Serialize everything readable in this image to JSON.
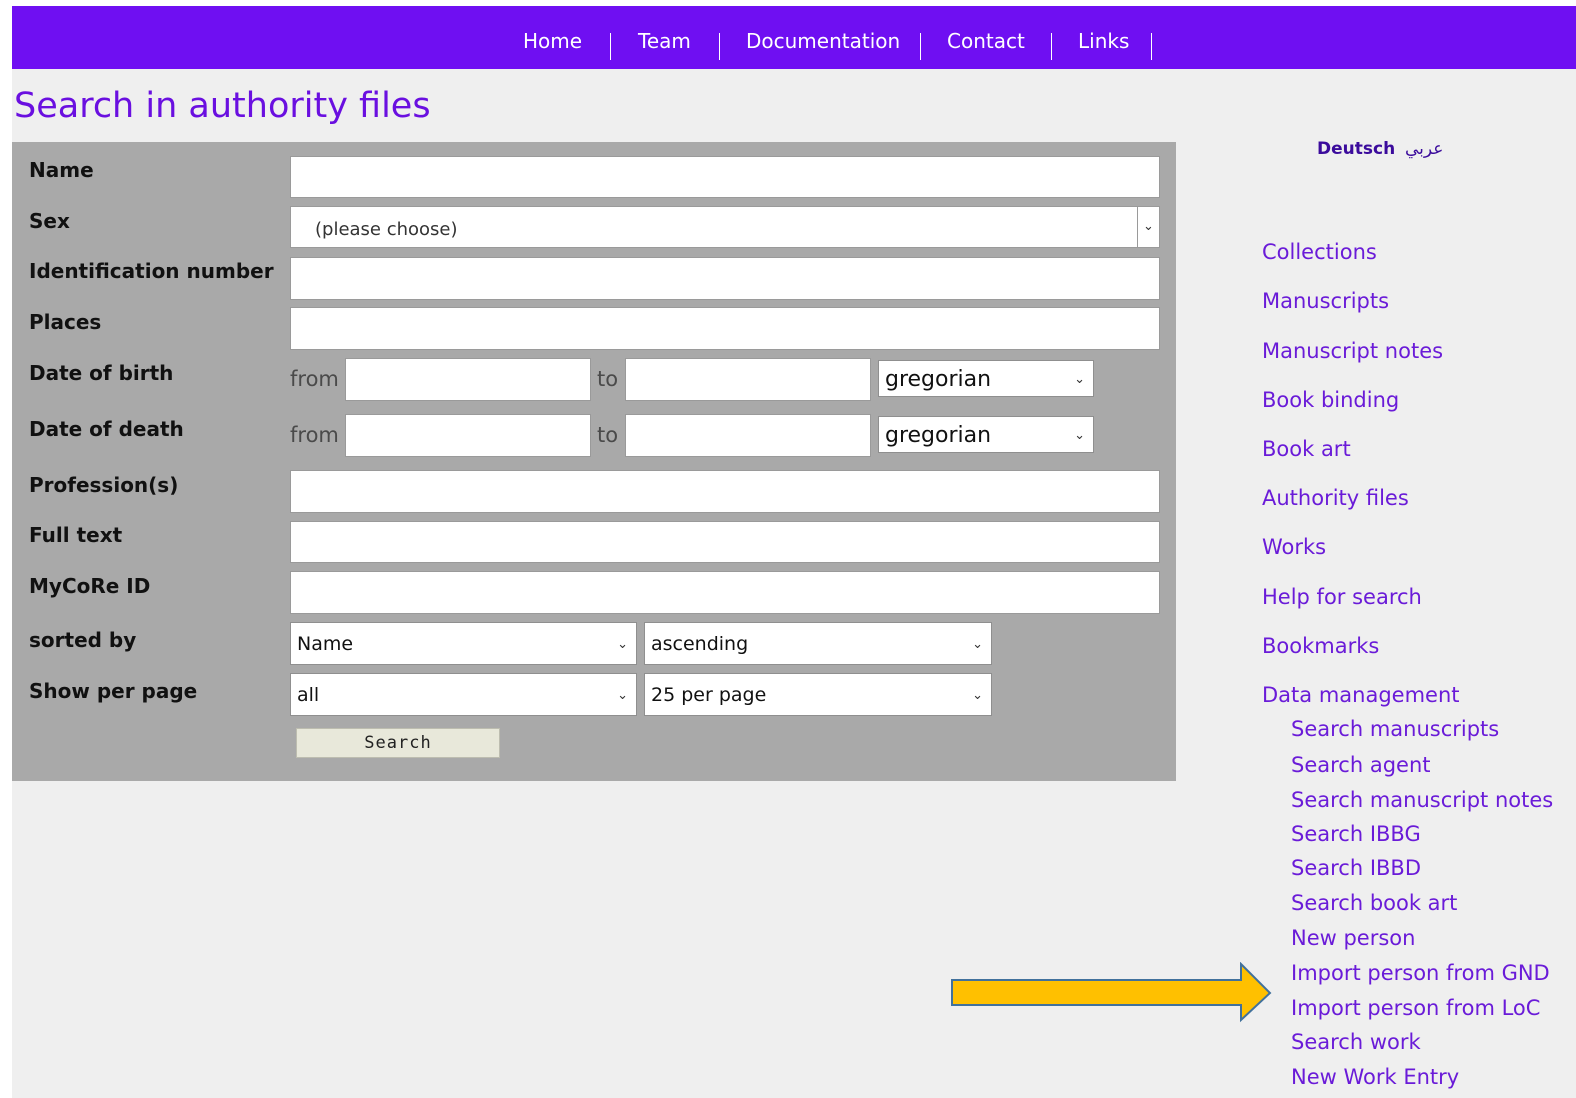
{
  "nav": {
    "items": [
      "Home",
      "Team",
      "Documentation",
      "Contact",
      "Links"
    ]
  },
  "page": {
    "title": "Search in authority files"
  },
  "form": {
    "name_label": "Name",
    "sex_label": "Sex",
    "sex_value": "(please choose)",
    "idnum_label": "Identification number",
    "places_label": "Places",
    "birth_label": "Date of birth",
    "death_label": "Date of death",
    "from_text": "from",
    "to_text": "to",
    "calendar_value": "gregorian",
    "profession_label": "Profession(s)",
    "fulltext_label": "Full text",
    "mycore_label": "MyCoRe ID",
    "sorted_label": "sorted by",
    "sort_field_value": "Name",
    "sort_order_value": "ascending",
    "perpage_label": "Show per page",
    "filter_value": "all",
    "perpage_value": "25 per page",
    "search_button": "Search"
  },
  "languages": {
    "german": "Deutsch",
    "arabic": "عربي"
  },
  "sidebar": {
    "links": [
      "Collections",
      "Manuscripts",
      "Manuscript notes",
      "Book binding",
      "Book art",
      "Authority files",
      "Works",
      "Help for search",
      "Bookmarks",
      "Data management"
    ],
    "sub_links": [
      "Search manuscripts",
      "Search agent",
      "Search manuscript notes",
      "Search IBBG",
      "Search IBBD",
      "Search book art",
      "New person",
      "Import person from GND",
      "Import person from LoC",
      "Search work",
      "New Work Entry"
    ]
  },
  "colors": {
    "nav_bg": "#6f0ff2",
    "link": "#6a1bd8",
    "panel": "#a9a9a9",
    "arrow_fill": "#ffc000",
    "arrow_stroke": "#41719c"
  },
  "icons": {
    "select": "chevron-down-icon",
    "annotation": "arrow-right-icon"
  }
}
